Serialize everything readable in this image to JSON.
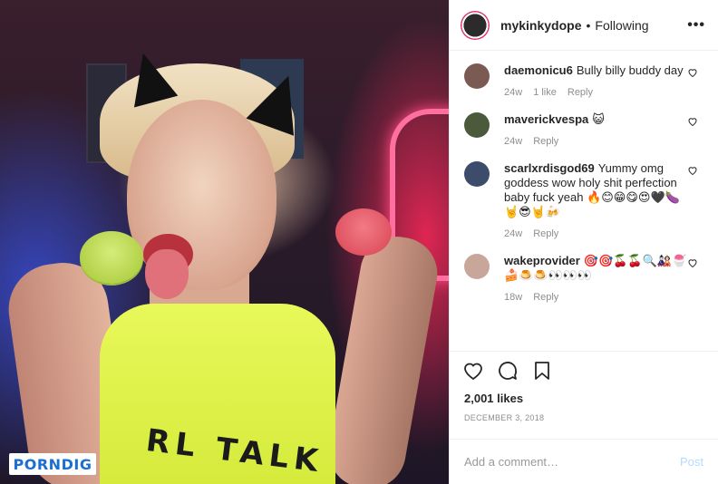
{
  "watermark": {
    "part1": "PORN",
    "part2": "DIG"
  },
  "photo": {
    "shirt_text": "RL TALK"
  },
  "header": {
    "username": "mykinkydope",
    "separator": "•",
    "follow_status": "Following",
    "more": "•••"
  },
  "comments": [
    {
      "username": "daemonicu6",
      "text": "Bully billy buddy day",
      "age": "24w",
      "likes": "1 like",
      "reply": "Reply",
      "avatar_color": "#7a5a52"
    },
    {
      "username": "maverickvespa",
      "text": "😺",
      "age": "24w",
      "likes": "",
      "reply": "Reply",
      "avatar_color": "#4a5a3a"
    },
    {
      "username": "scarlxrdisgod69",
      "text": "Yummy omg goddess wow holy shit perfection baby fuck yeah 🔥😊😁😋😍🖤🍆🤘😎🤘🍻",
      "age": "24w",
      "likes": "",
      "reply": "Reply",
      "avatar_color": "#3c4c6a"
    },
    {
      "username": "wakeprovider",
      "text": "🎯🎯🍒🍒🔍🎎🍧🍰🍮🍮👀👀👀",
      "age": "18w",
      "likes": "",
      "reply": "Reply",
      "avatar_color": "#c9a69a"
    }
  ],
  "actions": {
    "likes": "2,001 likes",
    "date": "DECEMBER 3, 2018"
  },
  "add_comment": {
    "placeholder": "Add a comment…",
    "post": "Post"
  },
  "colors": {
    "accent": "#0095f6",
    "post_disabled": "#b3dbff",
    "muted": "#8e8e8e",
    "border": "#efefef"
  }
}
